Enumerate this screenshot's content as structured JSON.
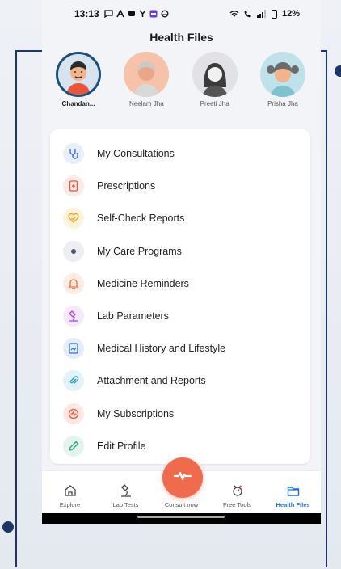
{
  "status_bar": {
    "time": "13:13",
    "battery": "12%"
  },
  "header": {
    "title": "Health Files"
  },
  "profiles": [
    {
      "name": "Chandan...",
      "active": true
    },
    {
      "name": "Neelam Jha",
      "active": false
    },
    {
      "name": "Preeti Jha",
      "active": false
    },
    {
      "name": "Prisha Jha",
      "active": false
    }
  ],
  "menu": [
    {
      "label": "My Consultations",
      "icon": "stethoscope-icon"
    },
    {
      "label": "Prescriptions",
      "icon": "prescription-icon"
    },
    {
      "label": "Self-Check Reports",
      "icon": "heart-check-icon"
    },
    {
      "label": "My Care Programs",
      "icon": "care-program-icon"
    },
    {
      "label": "Medicine Reminders",
      "icon": "bell-icon"
    },
    {
      "label": "Lab Parameters",
      "icon": "microscope-icon"
    },
    {
      "label": "Medical History and Lifestyle",
      "icon": "history-document-icon"
    },
    {
      "label": "Attachment and Reports",
      "icon": "paperclip-icon"
    },
    {
      "label": "My Subscriptions",
      "icon": "subscription-icon"
    },
    {
      "label": "Edit Profile",
      "icon": "pencil-icon"
    }
  ],
  "bottom_nav": [
    {
      "label": "Explore",
      "icon": "home-icon"
    },
    {
      "label": "Lab Tests",
      "icon": "microscope-icon"
    },
    {
      "label": "Consult now",
      "icon": "heartbeat-icon"
    },
    {
      "label": "Free Tools",
      "icon": "tools-icon"
    },
    {
      "label": "Health Files",
      "icon": "folder-icon",
      "active": true
    }
  ],
  "colors": {
    "accent": "#1d6fd1",
    "consult_fab": "#f06a4d",
    "active_avatar_border": "#1d4f7c",
    "frame": "#1f3566"
  }
}
